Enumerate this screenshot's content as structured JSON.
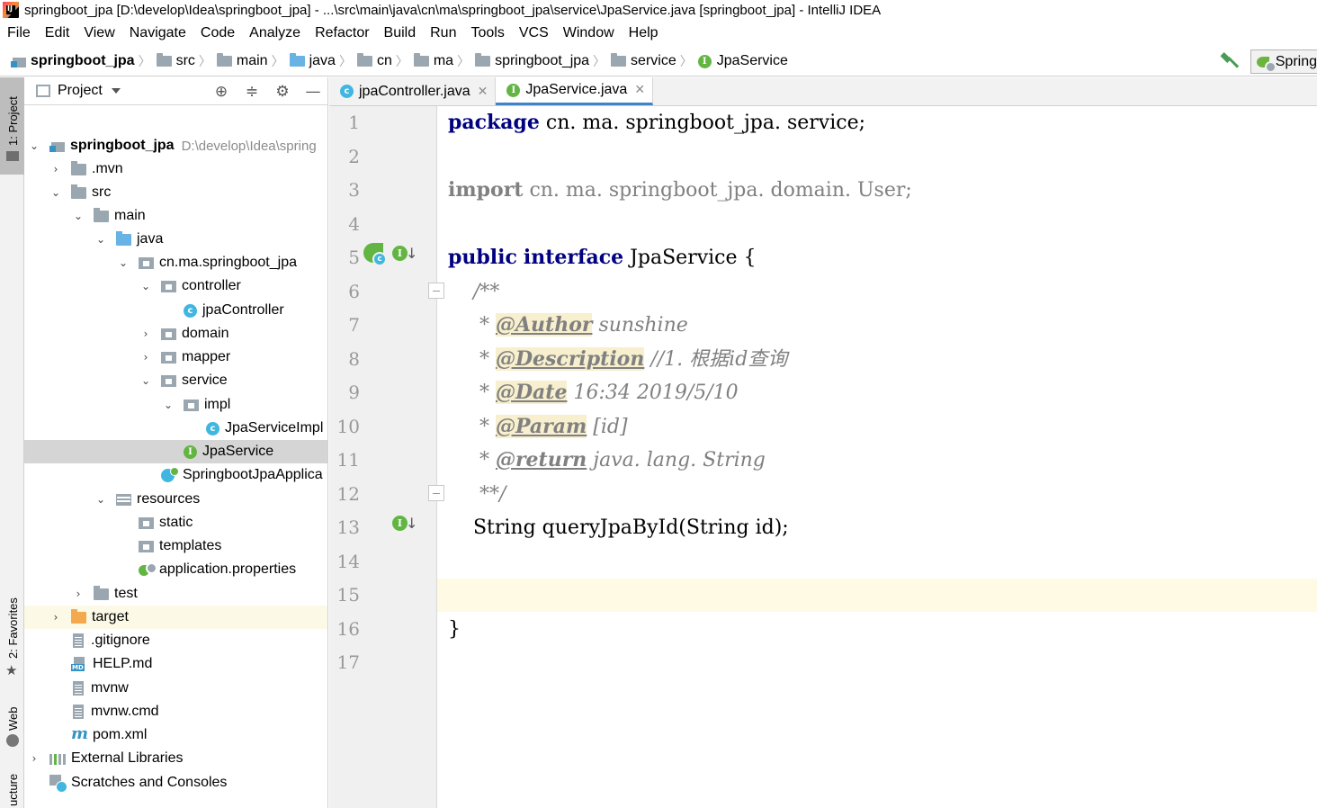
{
  "window": {
    "title": "springboot_jpa [D:\\develop\\Idea\\springboot_jpa] - ...\\src\\main\\java\\cn\\ma\\springboot_jpa\\service\\JpaService.java [springboot_jpa] - IntelliJ IDEA"
  },
  "menu": [
    "File",
    "Edit",
    "View",
    "Navigate",
    "Code",
    "Analyze",
    "Refactor",
    "Build",
    "Run",
    "Tools",
    "VCS",
    "Window",
    "Help"
  ],
  "breadcrumb": {
    "items": [
      "springboot_jpa",
      "src",
      "main",
      "java",
      "cn",
      "ma",
      "springboot_jpa",
      "service",
      "JpaService"
    ],
    "run_config": "Spring"
  },
  "side_strip": {
    "project": "1: Project",
    "favorites": "2: Favorites",
    "web": "Web",
    "structure": "ucture"
  },
  "project_panel": {
    "title": "Project",
    "root_name": "springboot_jpa",
    "root_path": "D:\\develop\\Idea\\spring",
    "tree": [
      {
        "label": ".mvn"
      },
      {
        "label": "src"
      },
      {
        "label": "main"
      },
      {
        "label": "java"
      },
      {
        "label": "cn.ma.springboot_jpa"
      },
      {
        "label": "controller"
      },
      {
        "label": "jpaController"
      },
      {
        "label": "domain"
      },
      {
        "label": "mapper"
      },
      {
        "label": "service"
      },
      {
        "label": "impl"
      },
      {
        "label": "JpaServiceImpl"
      },
      {
        "label": "JpaService"
      },
      {
        "label": "SpringbootJpaApplica"
      },
      {
        "label": "resources"
      },
      {
        "label": "static"
      },
      {
        "label": "templates"
      },
      {
        "label": "application.properties"
      },
      {
        "label": "test"
      },
      {
        "label": "target"
      },
      {
        "label": ".gitignore"
      },
      {
        "label": "HELP.md"
      },
      {
        "label": "mvnw"
      },
      {
        "label": "mvnw.cmd"
      },
      {
        "label": "pom.xml"
      },
      {
        "label": "External Libraries"
      },
      {
        "label": "Scratches and Consoles"
      }
    ]
  },
  "tabs": [
    {
      "label": "jpaController.java",
      "active": false
    },
    {
      "label": "JpaService.java",
      "active": true
    }
  ],
  "editor": {
    "line_numbers": [
      "1",
      "2",
      "3",
      "4",
      "5",
      "6",
      "7",
      "8",
      "9",
      "10",
      "11",
      "12",
      "13",
      "14",
      "15",
      "16",
      "17"
    ],
    "current_line": "15",
    "code": {
      "l1_kw": "package",
      "l1_rest": " cn. ma. springboot_jpa. service;",
      "l3_kw": "import",
      "l3_rest": " cn. ma. springboot_jpa. domain. User;",
      "l5_kw1": "public",
      "l5_kw2": "interface",
      "l5_rest": " JpaService {",
      "l6": "    /**",
      "l7_star": "     * ",
      "l7_tag": "@Author",
      "l7_text": " sunshine",
      "l8_star": "     * ",
      "l8_tag": "@Description",
      "l8_text": " //1. 根据id查询",
      "l9_star": "     * ",
      "l9_tag": "@Date",
      "l9_text": " 16:34 2019/5/10",
      "l10_star": "     * ",
      "l10_tag": "@Param",
      "l10_text": " [id]",
      "l11_star": "     * ",
      "l11_tag": "@return",
      "l11_text": " java. lang. String",
      "l12": "     **/",
      "l13": "    String queryJpaById(String id);",
      "l16": "}"
    }
  },
  "colors": {
    "keyword": "#000080",
    "comment": "#808080",
    "current_line": "#fffae3",
    "selection": "#d5d5d5",
    "interface_icon": "#62b543",
    "class_icon": "#40b6e0"
  }
}
